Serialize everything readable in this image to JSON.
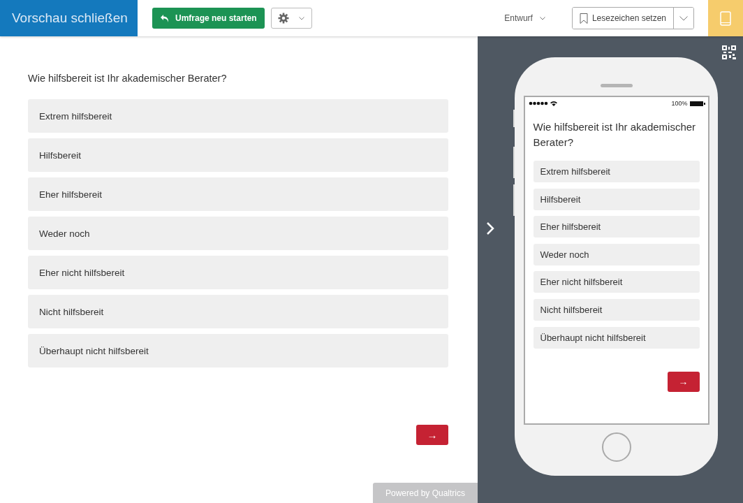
{
  "toolbar": {
    "close_preview": "Vorschau schließen",
    "restart_button": "Umfrage neu starten",
    "status": "Entwurf",
    "bookmark_button": "Lesezeichen setzen"
  },
  "survey": {
    "question": "Wie hilfsbereit ist Ihr akademischer Berater?",
    "options": [
      {
        "label": "Extrem hilfsbereit",
        "selected": false
      },
      {
        "label": "Hilfsbereit",
        "selected": false
      },
      {
        "label": "Eher hilfsbereit",
        "selected": false
      },
      {
        "label": "Weder noch",
        "selected": false
      },
      {
        "label": "Eher nicht hilfsbereit",
        "selected": false
      },
      {
        "label": "Nicht hilfsbereit",
        "selected": false
      },
      {
        "label": "Überhaupt nicht hilfsbereit",
        "selected": false
      }
    ],
    "next_button": "→",
    "footer": "Powered by Qualtrics"
  },
  "mobile_preview": {
    "battery": "100%",
    "question": "Wie hilfsbereit ist Ihr akademischer Berater?",
    "options": [
      {
        "label": "Extrem hilfsbereit",
        "selected": false
      },
      {
        "label": "Hilfsbereit",
        "selected": false
      },
      {
        "label": "Eher hilfsbereit",
        "selected": false
      },
      {
        "label": "Weder noch",
        "selected": false
      },
      {
        "label": "Eher nicht hilfsbereit",
        "selected": false
      },
      {
        "label": "Nicht hilfsbereit",
        "selected": false
      },
      {
        "label": "Überhaupt nicht hilfsbereit",
        "selected": false
      }
    ],
    "next_button": "→"
  }
}
